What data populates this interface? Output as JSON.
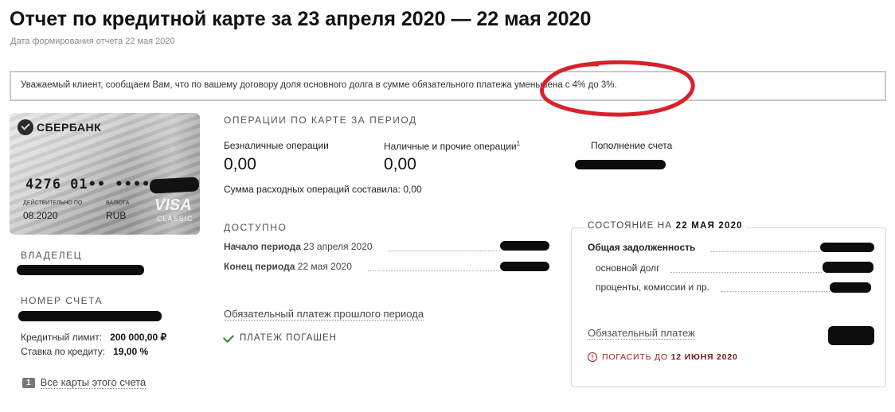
{
  "header": {
    "title": "Отчет по кредитной карте за 23 апреля 2020 — 22 мая 2020",
    "report_date": "Дата формирования отчета 22 мая 2020"
  },
  "notice": "Уважаемый клиент, сообщаем Вам, что по вашему договору доля основного долга в сумме обязательного платежа уменьшена с 4% до 3%.",
  "card": {
    "bank_name": "СБЕРБАНК",
    "number_visible": "4276 01•• ••••",
    "valid_label": "ДЕЙСТВИТЕЛЬНО ПО",
    "valid_value": "08.2020",
    "currency_label": "ВАЛЮТА",
    "currency_value": "RUB",
    "network": "VISA",
    "network_tier": "CLASSIC"
  },
  "owner": {
    "label": "ВЛАДЕЛЕЦ"
  },
  "account": {
    "label": "НОМЕР СЧЕТА",
    "credit_limit_label": "Кредитный лимит:",
    "credit_limit_value": "200 000,00 ₽",
    "rate_label": "Ставка по кредиту:",
    "rate_value": "19,00 %"
  },
  "all_cards": {
    "count": "1",
    "label": "Все карты этого счета"
  },
  "operations": {
    "title": "ОПЕРАЦИИ ПО КАРТЕ ЗА ПЕРИОД",
    "cashless_label": "Безналичные операции",
    "cashless_value": "0,00",
    "cash_label": "Наличные и прочие операции",
    "cash_footnote": "1",
    "cash_value": "0,00",
    "topup_label": "Пополнение счета",
    "sum_text": "Сумма расходных операций составила: 0,00"
  },
  "available": {
    "title": "ДОСТУПНО",
    "start_label": "Начало периода",
    "start_date": "23 апреля 2020",
    "end_label": "Конец периода",
    "end_date": "22 мая 2020"
  },
  "prev_payment": {
    "link": "Обязательный платеж прошлого периода",
    "status": "ПЛАТЕЖ ПОГАШЕН"
  },
  "status": {
    "title_prefix": "СОСТОЯНИЕ НА",
    "title_date": "22 МАЯ 2020",
    "total_debt": "Общая задолженность",
    "principal": "основной долг",
    "interest": "проценты, комиссии и пр.",
    "mandatory_payment": "Обязательный платеж",
    "pay_by_prefix": "ПОГАСИТЬ ДО",
    "pay_by_date": "12 ИЮНЯ 2020"
  },
  "colors": {
    "annotation": "#d8212a",
    "check": "#2e8b2e",
    "warning": "#a02020"
  }
}
